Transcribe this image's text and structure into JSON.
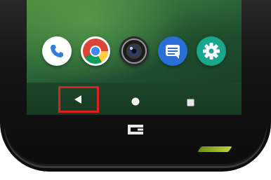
{
  "device": {
    "brand_logo": "crosscall-logo-icon",
    "accent_color": "#a6c531"
  },
  "dock": {
    "apps": [
      {
        "name": "phone",
        "icon": "phone-icon",
        "color": "#ffffff",
        "glyph_color": "#2f7de1"
      },
      {
        "name": "chrome",
        "icon": "chrome-icon",
        "color": "#ffffff"
      },
      {
        "name": "camera",
        "icon": "camera-icon",
        "color": "#2b2b2b"
      },
      {
        "name": "messages",
        "icon": "messages-icon",
        "color": "#2a6fd6"
      },
      {
        "name": "settings",
        "icon": "settings-icon",
        "color": "#1aa68a"
      }
    ]
  },
  "navigation_bar": {
    "buttons": [
      {
        "name": "back",
        "icon": "back-triangle-icon",
        "highlighted": true,
        "highlight_color": "#e02020"
      },
      {
        "name": "home",
        "icon": "home-circle-icon"
      },
      {
        "name": "recents",
        "icon": "recents-square-icon"
      }
    ]
  }
}
